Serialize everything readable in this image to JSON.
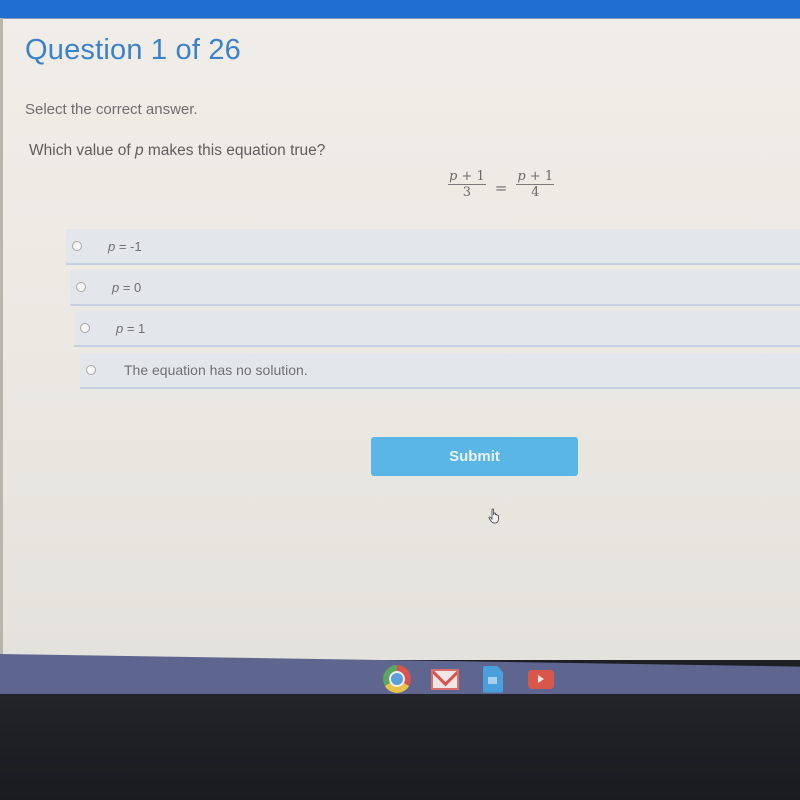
{
  "header": {
    "question_title": "Question 1 of 26"
  },
  "question": {
    "instruction": "Select the correct answer.",
    "prompt_before": "Which value of ",
    "prompt_var": "p",
    "prompt_after": " makes this equation true?",
    "equation": {
      "left": {
        "numerator_var": "p",
        "numerator_rest": " + 1",
        "denominator": "3"
      },
      "operator": "=",
      "right": {
        "numerator_var": "p",
        "numerator_rest": " + 1",
        "denominator": "4"
      }
    }
  },
  "options": [
    {
      "var": "p",
      "rest": " = -1",
      "selected": false
    },
    {
      "var": "p",
      "rest": " = 0",
      "selected": false
    },
    {
      "var": "p",
      "rest": " = 1",
      "selected": false
    },
    {
      "text": "The equation has no solution.",
      "selected": false
    }
  ],
  "actions": {
    "submit_label": "Submit"
  },
  "shelf": {
    "apps": [
      {
        "name": "Chrome",
        "icon": "chrome-icon",
        "active": true
      },
      {
        "name": "Gmail",
        "icon": "gmail-icon",
        "active": false
      },
      {
        "name": "Docs",
        "icon": "docs-icon",
        "active": false
      },
      {
        "name": "YouTube",
        "icon": "youtube-icon",
        "active": false
      }
    ]
  },
  "colors": {
    "top_bar": "#1f6fd1",
    "title": "#3b82c8",
    "submit_button": "#5ab6e6",
    "option_background": "#e3e6ea",
    "shelf": "#5e6690"
  }
}
